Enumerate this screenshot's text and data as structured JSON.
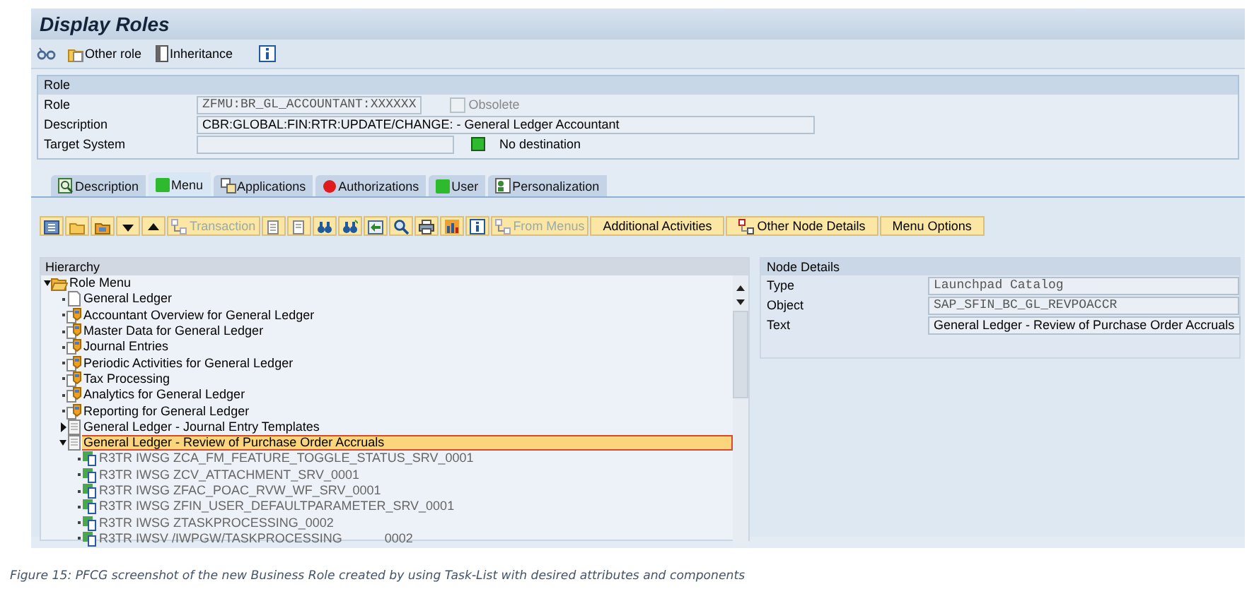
{
  "window": {
    "title": "Display Roles"
  },
  "toolbar": [
    {
      "kind": "icon"
    },
    {
      "kind": "text",
      "label": "Other role"
    },
    {
      "kind": "text",
      "label": "Inheritance"
    },
    {
      "kind": "info"
    }
  ],
  "role_group": {
    "title": "Role",
    "role": {
      "label": "Role",
      "value": "ZFMU:BR_GL_ACCOUNTANT:XXXXXX"
    },
    "obsolete": {
      "label": "Obsolete",
      "checked": false,
      "disabled": true
    },
    "description": {
      "label": "Description",
      "value": "CBR:GLOBAL:FIN:RTR:UPDATE/CHANGE: - General Ledger Accountant"
    },
    "target_system": {
      "label": "Target System",
      "color": "#2dbb2d",
      "status_text": "No destination"
    }
  },
  "tabs": [
    {
      "label": "Description",
      "kind": "description",
      "selected": false
    },
    {
      "label": "Menu",
      "kind": "status",
      "color": "#2dbb2d",
      "selected": true
    },
    {
      "label": "Applications",
      "kind": "applications",
      "selected": false
    },
    {
      "label": "Authorizations",
      "kind": "status",
      "color": "#e01b1b",
      "selected": false
    },
    {
      "label": "User",
      "kind": "status",
      "color": "#2dbb2d",
      "selected": false
    },
    {
      "label": "Personalization",
      "kind": "personalization",
      "selected": false
    }
  ],
  "app_toolbar": [
    {
      "kind": "icon"
    },
    {
      "kind": "icon"
    },
    {
      "kind": "icon"
    },
    {
      "kind": "icon"
    },
    {
      "kind": "icon"
    },
    {
      "kind": "text",
      "label": "Transaction",
      "disabled": true
    },
    {
      "kind": "icon"
    },
    {
      "kind": "icon"
    },
    {
      "kind": "icon"
    },
    {
      "kind": "icon"
    },
    {
      "kind": "icon"
    },
    {
      "kind": "icon"
    },
    {
      "kind": "icon"
    },
    {
      "kind": "icon"
    },
    {
      "kind": "icon"
    },
    {
      "kind": "text",
      "label": "From Menus",
      "disabled": true
    },
    {
      "kind": "text",
      "label": "Additional Activities",
      "disabled": false
    },
    {
      "kind": "text",
      "label": "Other Node Details",
      "disabled": false
    },
    {
      "kind": "text",
      "label": "Menu Options",
      "disabled": false
    }
  ],
  "hierarchy": {
    "title": "Hierarchy",
    "nodes": [
      {
        "label": "Role Menu",
        "kind": "folder",
        "expanded": true,
        "selected": false,
        "children": [
          {
            "label": "General Ledger",
            "kind": "document",
            "selected": false
          },
          {
            "label": "Accountant Overview for General Ledger",
            "kind": "catalog",
            "selected": false
          },
          {
            "label": "Master Data for General Ledger",
            "kind": "catalog",
            "selected": false
          },
          {
            "label": "Journal Entries",
            "kind": "catalog",
            "selected": false
          },
          {
            "label": "Periodic Activities for General Ledger",
            "kind": "catalog",
            "selected": false
          },
          {
            "label": "Tax Processing",
            "kind": "catalog",
            "selected": false
          },
          {
            "label": "Analytics for General Ledger",
            "kind": "catalog",
            "selected": false
          },
          {
            "label": "Reporting for General Ledger",
            "kind": "catalog",
            "selected": false
          },
          {
            "label": "General Ledger - Journal Entry Templates",
            "kind": "template",
            "expanded": false,
            "selected": false
          },
          {
            "label": "General Ledger - Review of Purchase Order Accruals",
            "kind": "template",
            "expanded": true,
            "selected": true,
            "children": [
              {
                "label": "R3TR IWSG ZCA_FM_FEATURE_TOGGLE_STATUS_SRV_0001",
                "kind": "service",
                "selected": false
              },
              {
                "label": "R3TR IWSG ZCV_ATTACHMENT_SRV_0001",
                "kind": "service",
                "selected": false
              },
              {
                "label": "R3TR IWSG ZFAC_POAC_RVW_WF_SRV_0001",
                "kind": "service",
                "selected": false
              },
              {
                "label": "R3TR IWSG ZFIN_USER_DEFAULTPARAMETER_SRV_0001",
                "kind": "service",
                "selected": false
              },
              {
                "label": "R3TR IWSG ZTASKPROCESSING_0002",
                "kind": "service",
                "selected": false
              },
              {
                "label": "R3TR IWSV /IWPGW/TASKPROCESSING            0002",
                "kind": "service",
                "selected": false
              }
            ]
          }
        ]
      }
    ]
  },
  "node_details": {
    "title": "Node Details",
    "rows": [
      {
        "label": "Type",
        "value": "Launchpad Catalog",
        "kind": "mono"
      },
      {
        "label": "Object",
        "value": "SAP_SFIN_BC_GL_REVPOACCR",
        "kind": "mono"
      },
      {
        "label": "Text",
        "value": "General Ledger - Review of Purchase Order Accruals",
        "kind": "plain"
      }
    ]
  },
  "caption": "Figure 15: PFCG screenshot of the new Business Role created by using Task-List with desired attributes and components"
}
